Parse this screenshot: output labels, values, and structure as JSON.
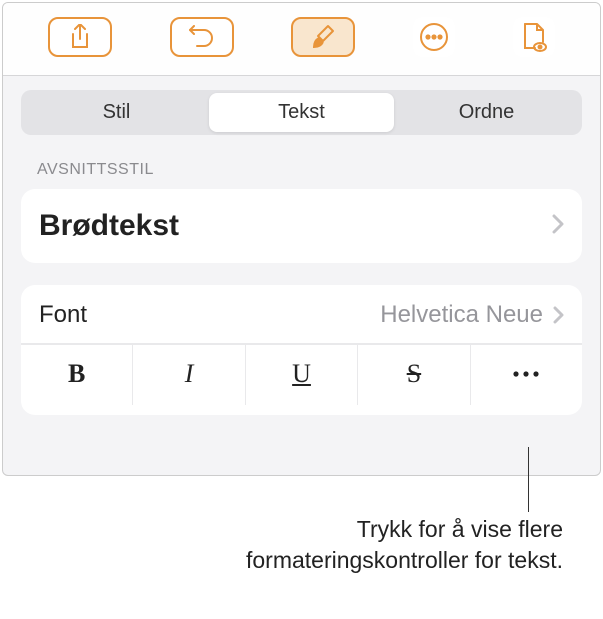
{
  "toolbar": {
    "share_icon": "share",
    "undo_icon": "undo",
    "format_icon": "paintbrush",
    "more_icon": "more",
    "document_icon": "document-view"
  },
  "tabs": {
    "items": [
      {
        "label": "Stil",
        "active": false
      },
      {
        "label": "Tekst",
        "active": true
      },
      {
        "label": "Ordne",
        "active": false
      }
    ]
  },
  "paragraph_style": {
    "section_label": "AVSNITTSSTIL",
    "current": "Brødtekst"
  },
  "font": {
    "label": "Font",
    "value": "Helvetica Neue"
  },
  "format_buttons": {
    "bold": "B",
    "italic": "I",
    "underline": "U",
    "strike": "S",
    "more": "•••"
  },
  "callout": {
    "line1": "Trykk for å vise flere",
    "line2": "formateringskontroller for tekst."
  },
  "colors": {
    "accent": "#e8943a"
  }
}
